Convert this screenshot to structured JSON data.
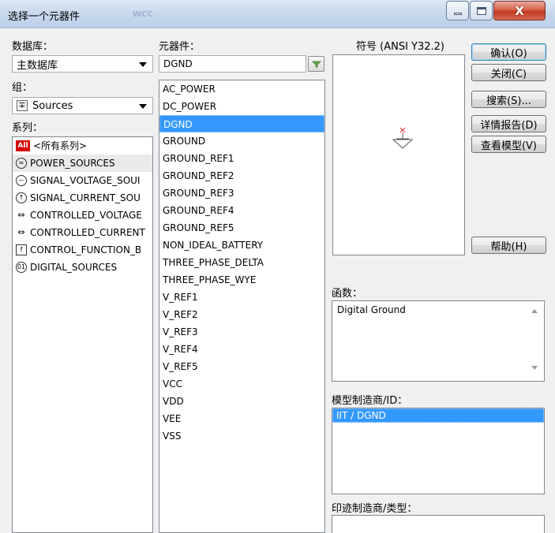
{
  "window": {
    "title": "选择一个元器件",
    "ghost_text": "WCC",
    "close_glyph": "X"
  },
  "labels": {
    "database": "数据库：",
    "group": "组：",
    "family": "系列：",
    "component": "元器件：",
    "symbol": "符号 (ANSI Y32.2)",
    "function": "函数：",
    "model_manufacturer": "模型制造商/ID：",
    "footprint_manufacturer": "印迹制造商/类型："
  },
  "database": {
    "value": "主数据库"
  },
  "group": {
    "value": "Sources",
    "icon": "sources-icon"
  },
  "component": {
    "value": "DGND"
  },
  "families": [
    {
      "label": "<所有系列>",
      "icon": "All"
    },
    {
      "label": "POWER_SOURCES",
      "icon": "PWR"
    },
    {
      "label": "SIGNAL_VOLTAGE_SOUI",
      "icon": "~"
    },
    {
      "label": "SIGNAL_CURRENT_SOU",
      "icon": "~"
    },
    {
      "label": "CONTROLLED_VOLTAGE",
      "icon": "◇"
    },
    {
      "label": "CONTROLLED_CURRENT",
      "icon": "◇"
    },
    {
      "label": "CONTROL_FUNCTION_B",
      "icon": "f"
    },
    {
      "label": "DIGITAL_SOURCES",
      "icon": "101"
    }
  ],
  "components": [
    "AC_POWER",
    "DC_POWER",
    "DGND",
    "GROUND",
    "GROUND_REF1",
    "GROUND_REF2",
    "GROUND_REF3",
    "GROUND_REF4",
    "GROUND_REF5",
    "NON_IDEAL_BATTERY",
    "THREE_PHASE_DELTA",
    "THREE_PHASE_WYE",
    "V_REF1",
    "V_REF2",
    "V_REF3",
    "V_REF4",
    "V_REF5",
    "VCC",
    "VDD",
    "VEE",
    "VSS"
  ],
  "selected_component": "DGND",
  "function_text": "Digital Ground",
  "model_items": [
    "IIT / DGND"
  ],
  "buttons": {
    "ok": "确认(O)",
    "close": "关闭(C)",
    "search": "搜索(S)...",
    "detail_report": "详情报告(D)",
    "view_model": "查看模型(V)",
    "help": "帮助(H)"
  },
  "colors": {
    "selection": "#3399ff",
    "all_badge": "#d40000"
  }
}
